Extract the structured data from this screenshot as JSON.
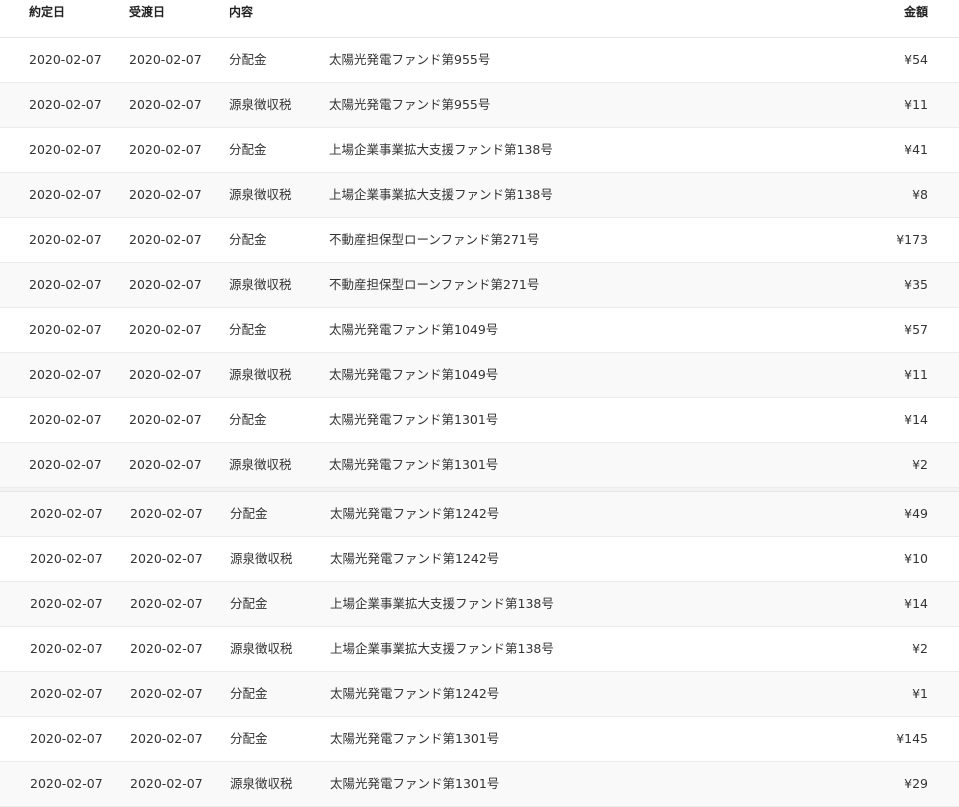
{
  "header": {
    "yakujo": "約定日",
    "ukewatashi": "受渡日",
    "naiyo": "内容",
    "kingaku": "金額"
  },
  "rows": [
    {
      "yakujo": "2020-02-07",
      "ukewatashi": "2020-02-07",
      "type": "分配金",
      "desc": "太陽光発電ファンド第955号",
      "amount": "¥54"
    },
    {
      "yakujo": "2020-02-07",
      "ukewatashi": "2020-02-07",
      "type": "源泉徴収税",
      "desc": "太陽光発電ファンド第955号",
      "amount": "¥11"
    },
    {
      "yakujo": "2020-02-07",
      "ukewatashi": "2020-02-07",
      "type": "分配金",
      "desc": "上場企業事業拡大支援ファンド第138号",
      "amount": "¥41"
    },
    {
      "yakujo": "2020-02-07",
      "ukewatashi": "2020-02-07",
      "type": "源泉徴収税",
      "desc": "上場企業事業拡大支援ファンド第138号",
      "amount": "¥8"
    },
    {
      "yakujo": "2020-02-07",
      "ukewatashi": "2020-02-07",
      "type": "分配金",
      "desc": "不動産担保型ローンファンド第271号",
      "amount": "¥173"
    },
    {
      "yakujo": "2020-02-07",
      "ukewatashi": "2020-02-07",
      "type": "源泉徴収税",
      "desc": "不動産担保型ローンファンド第271号",
      "amount": "¥35"
    },
    {
      "yakujo": "2020-02-07",
      "ukewatashi": "2020-02-07",
      "type": "分配金",
      "desc": "太陽光発電ファンド第1049号",
      "amount": "¥57"
    },
    {
      "yakujo": "2020-02-07",
      "ukewatashi": "2020-02-07",
      "type": "源泉徴収税",
      "desc": "太陽光発電ファンド第1049号",
      "amount": "¥11"
    },
    {
      "yakujo": "2020-02-07",
      "ukewatashi": "2020-02-07",
      "type": "分配金",
      "desc": "太陽光発電ファンド第1301号",
      "amount": "¥14"
    },
    {
      "yakujo": "2020-02-07",
      "ukewatashi": "2020-02-07",
      "type": "源泉徴収税",
      "desc": "太陽光発電ファンド第1301号",
      "amount": "¥2"
    }
  ],
  "rows2": [
    {
      "yakujo": "2020-02-07",
      "ukewatashi": "2020-02-07",
      "type": "分配金",
      "desc": "太陽光発電ファンド第1242号",
      "amount": "¥49"
    },
    {
      "yakujo": "2020-02-07",
      "ukewatashi": "2020-02-07",
      "type": "源泉徴収税",
      "desc": "太陽光発電ファンド第1242号",
      "amount": "¥10"
    },
    {
      "yakujo": "2020-02-07",
      "ukewatashi": "2020-02-07",
      "type": "分配金",
      "desc": "上場企業事業拡大支援ファンド第138号",
      "amount": "¥14"
    },
    {
      "yakujo": "2020-02-07",
      "ukewatashi": "2020-02-07",
      "type": "源泉徴収税",
      "desc": "上場企業事業拡大支援ファンド第138号",
      "amount": "¥2"
    },
    {
      "yakujo": "2020-02-07",
      "ukewatashi": "2020-02-07",
      "type": "分配金",
      "desc": "太陽光発電ファンド第1242号",
      "amount": "¥1"
    },
    {
      "yakujo": "2020-02-07",
      "ukewatashi": "2020-02-07",
      "type": "分配金",
      "desc": "太陽光発電ファンド第1301号",
      "amount": "¥145"
    },
    {
      "yakujo": "2020-02-07",
      "ukewatashi": "2020-02-07",
      "type": "源泉徴収税",
      "desc": "太陽光発電ファンド第1301号",
      "amount": "¥29"
    }
  ]
}
